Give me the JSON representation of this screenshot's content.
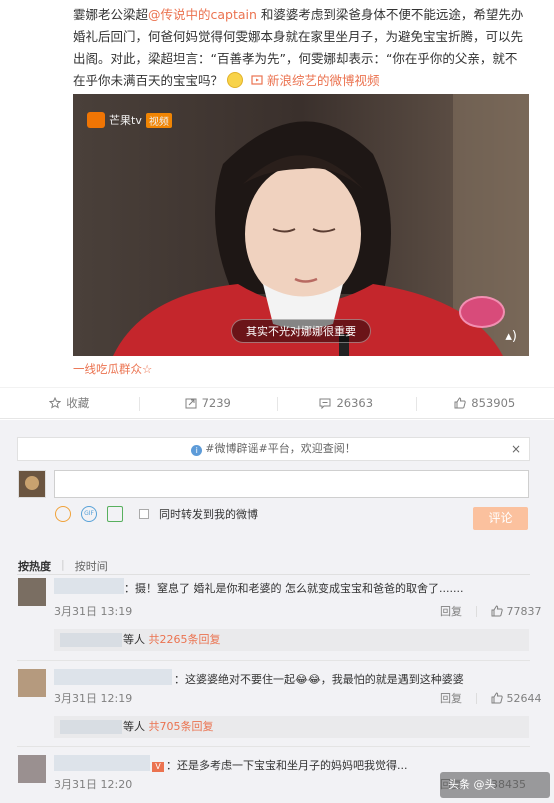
{
  "post": {
    "line1a": "霎娜老公梁超",
    "mention": "@传说中的captain",
    "line1b": " 和婆婆考虑到梁爸身体不便不能远途，希望先办婚礼后回门，何爸何妈觉得何雯娜本身就在家里坐月子，为避免宝宝折腾，可以先出阁。对此，梁超坦言：“百善孝为先”，何雯娜却表示：“你在乎你的父亲，就不在乎你未满百天的宝宝吗？",
    "video_link": "新浪综艺的微博视频",
    "video_subtitle": "其实不光对娜娜很重要",
    "video_logo": "芒果tv",
    "video_logo_tag": "视频",
    "source": "一线吃瓜群众☆"
  },
  "toolbar": {
    "fav_label": "收藏",
    "forward_count": "7239",
    "comment_count": "26363",
    "like_count": "853905"
  },
  "comment_box": {
    "notice": "#微博辟谣#平台，欢迎查阅！",
    "notice_close": "×",
    "sync_label": "同时转发到我的微博",
    "submit_label": "评论"
  },
  "sort": {
    "hot": "按热度",
    "time": "按时间"
  },
  "comments": [
    {
      "text": "：摄！窒息了 婚礼是你和老婆的 怎么就变成宝宝和爸爸的取舍了.......",
      "time": "3月31日 13:19",
      "reply": "回复",
      "likes": "77837",
      "sub_prefix": "等人",
      "sub_count": "共2265条回复"
    },
    {
      "text": "：这婆婆绝对不要住一起😂😂，我最怕的就是遇到这种婆婆",
      "time": "3月31日 12:19",
      "reply": "回复",
      "likes": "52644",
      "sub_prefix": "等人",
      "sub_count": "共705条回复"
    },
    {
      "text": "：还是多考虑一下宝宝和坐月子的妈妈吧我觉得...",
      "time": "3月31日 12:20",
      "reply": "回复",
      "likes": "38435"
    }
  ],
  "watermark": "头条 @头"
}
